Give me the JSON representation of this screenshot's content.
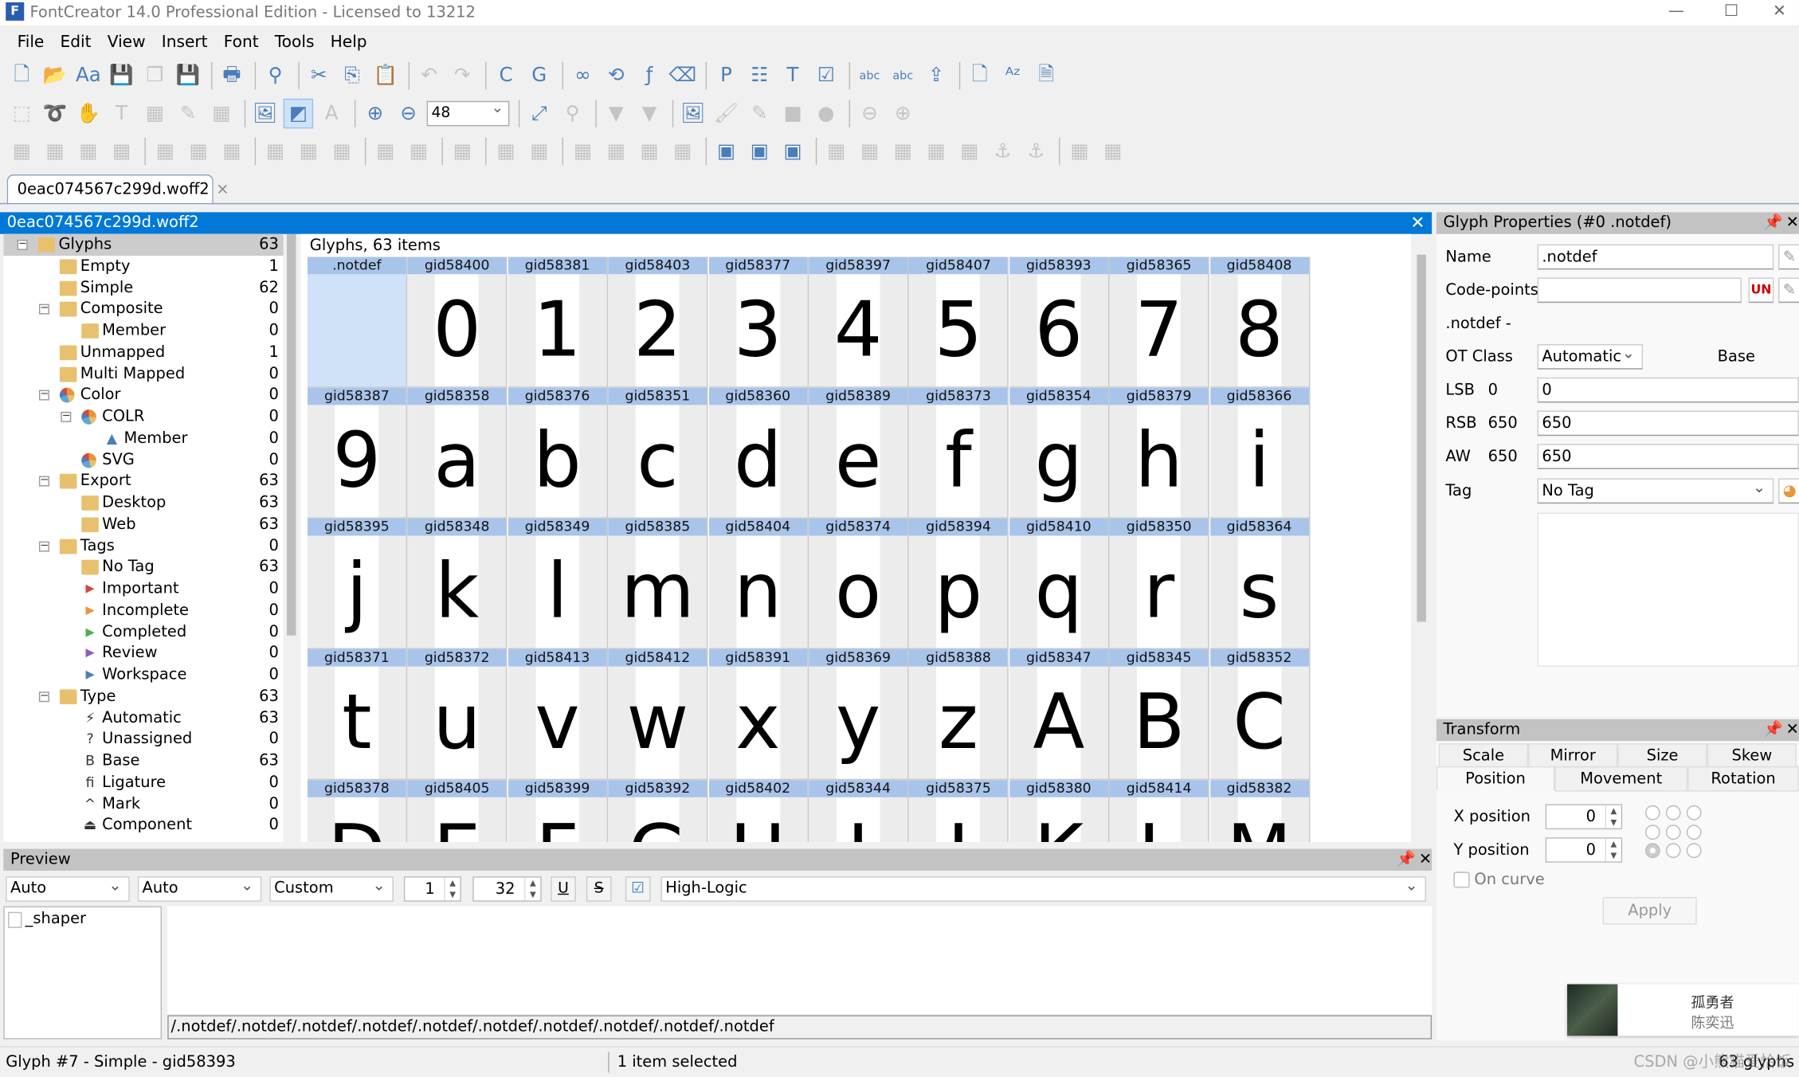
{
  "window": {
    "title": "FontCreator 14.0 Professional Edition - Licensed to 13212",
    "controls": [
      "minimize",
      "maximize",
      "close"
    ]
  },
  "menu": [
    "File",
    "Edit",
    "View",
    "Insert",
    "Font",
    "Tools",
    "Help"
  ],
  "toolbar": {
    "row1": [
      [
        "new-font",
        "e"
      ],
      [
        "open",
        "e"
      ],
      [
        "open-sample",
        "e"
      ],
      [
        "save",
        "e"
      ],
      [
        "save-all",
        "d"
      ],
      [
        "save-as",
        "e"
      ],
      "|",
      [
        "print",
        "e"
      ],
      "|",
      [
        "find",
        "e"
      ],
      "|",
      [
        "cut",
        "e"
      ],
      [
        "copy",
        "e"
      ],
      [
        "paste",
        "e"
      ],
      "|",
      [
        "undo",
        "d"
      ],
      [
        "redo",
        "d"
      ],
      "|",
      [
        "insert-codepoint",
        "e"
      ],
      [
        "insert-glyph",
        "e"
      ],
      "|",
      [
        "link",
        "e"
      ],
      [
        "unlink",
        "e"
      ],
      [
        "formula",
        "e"
      ],
      [
        "eraser",
        "e"
      ],
      "|",
      [
        "properties",
        "e"
      ],
      [
        "edit-table",
        "e"
      ],
      [
        "replace-text",
        "e"
      ],
      [
        "validate",
        "e"
      ],
      "|",
      [
        "spell-check",
        "e"
      ],
      [
        "web-check",
        "e"
      ],
      [
        "install-font",
        "e"
      ],
      "|",
      [
        "new-page",
        "e"
      ],
      [
        "sort-az",
        "e"
      ],
      [
        "export",
        "e"
      ]
    ],
    "row2": [
      [
        "select-rect",
        "d"
      ],
      [
        "lasso",
        "d"
      ],
      [
        "hand",
        "d"
      ],
      [
        "text-tool",
        "d"
      ],
      [
        "measure",
        "d"
      ],
      [
        "pen",
        "d"
      ],
      [
        "fill",
        "d"
      ],
      "|",
      [
        "background-image",
        "e"
      ],
      [
        "show-hide",
        "a"
      ],
      [
        "font-style",
        "d"
      ],
      "|",
      [
        "zoom-in",
        "e"
      ],
      [
        "zoom-out",
        "e"
      ],
      "zoom",
      "|",
      [
        "fit",
        "e"
      ],
      [
        "zoom-rect",
        "d"
      ],
      "|",
      [
        "triangle-down",
        "d"
      ],
      [
        "triangle-pin",
        "d"
      ],
      "|",
      [
        "image-insert",
        "e"
      ],
      [
        "brush",
        "d"
      ],
      [
        "pencil",
        "d"
      ],
      [
        "rectangle",
        "d"
      ],
      [
        "ellipse",
        "d"
      ],
      "|",
      [
        "back",
        "d"
      ],
      [
        "forward",
        "d"
      ]
    ],
    "row3": [
      [
        "group1",
        "d"
      ],
      [
        "group2",
        "d"
      ],
      [
        "group3",
        "d"
      ],
      [
        "group4",
        "d"
      ],
      "|",
      [
        "align-left",
        "d"
      ],
      [
        "align-center",
        "d"
      ],
      [
        "align-right",
        "d"
      ],
      "|",
      [
        "align-top",
        "d"
      ],
      [
        "align-middle",
        "d"
      ],
      [
        "align-bottom",
        "d"
      ],
      "|",
      [
        "distribute-h",
        "d"
      ],
      [
        "distribute-v",
        "d"
      ],
      "|",
      [
        "glyph-ref",
        "d"
      ],
      "|",
      [
        "rotate",
        "d"
      ],
      [
        "mirror",
        "d"
      ],
      "|",
      [
        "flip-left",
        "d"
      ],
      [
        "flip-v",
        "d"
      ],
      [
        "rotate-left",
        "d"
      ],
      [
        "rotate-right",
        "d"
      ],
      "|",
      [
        "union",
        "e"
      ],
      [
        "intersect",
        "e"
      ],
      [
        "exclude",
        "e"
      ],
      "|",
      [
        "grid",
        "d"
      ],
      [
        "grid-undo",
        "d"
      ],
      [
        "grid-lock",
        "d"
      ],
      [
        "columns",
        "d"
      ],
      [
        "columns-lock",
        "d"
      ],
      [
        "anchor",
        "d"
      ],
      [
        "anchor-lock",
        "d"
      ],
      "|",
      [
        "node",
        "d"
      ],
      [
        "hint",
        "d"
      ]
    ],
    "zoom_value": "48"
  },
  "doc_tab": {
    "label": "0eac074567c299d.woff2",
    "close": "×"
  },
  "doc_header": {
    "title": "0eac074567c299d.woff2",
    "close": "✕"
  },
  "tree": [
    {
      "label": "Glyphs",
      "count": "63",
      "level": 0,
      "icon": "folder",
      "toggle": "−",
      "selected": true
    },
    {
      "label": "Empty",
      "count": "1",
      "level": 1,
      "icon": "folder"
    },
    {
      "label": "Simple",
      "count": "62",
      "level": 1,
      "icon": "folder"
    },
    {
      "label": "Composite",
      "count": "0",
      "level": 1,
      "icon": "folder",
      "toggle": "−"
    },
    {
      "label": "Member",
      "count": "0",
      "level": 2,
      "icon": "folder"
    },
    {
      "label": "Unmapped",
      "count": "1",
      "level": 1,
      "icon": "folder"
    },
    {
      "label": "Multi Mapped",
      "count": "0",
      "level": 1,
      "icon": "folder"
    },
    {
      "label": "Color",
      "count": "0",
      "level": 1,
      "icon": "color-pie",
      "toggle": "−"
    },
    {
      "label": "COLR",
      "count": "0",
      "level": 2,
      "icon": "color-pie",
      "toggle": "−"
    },
    {
      "label": "Member",
      "count": "0",
      "level": 3,
      "icon": "triangle"
    },
    {
      "label": "SVG",
      "count": "0",
      "level": 2,
      "icon": "color-pie"
    },
    {
      "label": "Export",
      "count": "63",
      "level": 1,
      "icon": "folder",
      "toggle": "−"
    },
    {
      "label": "Desktop",
      "count": "63",
      "level": 2,
      "icon": "folder"
    },
    {
      "label": "Web",
      "count": "63",
      "level": 2,
      "icon": "folder"
    },
    {
      "label": "Tags",
      "count": "0",
      "level": 1,
      "icon": "folder",
      "toggle": "−"
    },
    {
      "label": "No Tag",
      "count": "63",
      "level": 2,
      "icon": "folder"
    },
    {
      "label": "Important",
      "count": "0",
      "level": 2,
      "icon": "flag",
      "color": "#d9463b"
    },
    {
      "label": "Incomplete",
      "count": "0",
      "level": 2,
      "icon": "flag",
      "color": "#e8963a"
    },
    {
      "label": "Completed",
      "count": "0",
      "level": 2,
      "icon": "flag",
      "color": "#4caf50"
    },
    {
      "label": "Review",
      "count": "0",
      "level": 2,
      "icon": "flag",
      "color": "#8e5cc7"
    },
    {
      "label": "Workspace",
      "count": "0",
      "level": 2,
      "icon": "flag",
      "color": "#4a7ebb"
    },
    {
      "label": "Type",
      "count": "63",
      "level": 1,
      "icon": "folder",
      "toggle": "−"
    },
    {
      "label": "Automatic",
      "count": "63",
      "level": 2,
      "icon": "lightning",
      "glyph": "⚡"
    },
    {
      "label": "Unassigned",
      "count": "0",
      "level": 2,
      "icon": "question",
      "glyph": "?"
    },
    {
      "label": "Base",
      "count": "63",
      "level": 2,
      "icon": "base",
      "glyph": "B"
    },
    {
      "label": "Ligature",
      "count": "0",
      "level": 2,
      "icon": "ligature",
      "glyph": "fi"
    },
    {
      "label": "Mark",
      "count": "0",
      "level": 2,
      "icon": "mark",
      "glyph": "^"
    },
    {
      "label": "Component",
      "count": "0",
      "level": 2,
      "icon": "component",
      "glyph": "⏏"
    }
  ],
  "grid": {
    "title": "Glyphs, 63 items",
    "rows": [
      [
        [
          ".notdef",
          ""
        ],
        [
          "gid58400",
          "0"
        ],
        [
          "gid58381",
          "1"
        ],
        [
          "gid58403",
          "2"
        ],
        [
          "gid58377",
          "3"
        ],
        [
          "gid58397",
          "4"
        ],
        [
          "gid58407",
          "5"
        ],
        [
          "gid58393",
          "6"
        ],
        [
          "gid58365",
          "7"
        ],
        [
          "gid58408",
          "8"
        ]
      ],
      [
        [
          "gid58387",
          "9"
        ],
        [
          "gid58358",
          "a"
        ],
        [
          "gid58376",
          "b"
        ],
        [
          "gid58351",
          "c"
        ],
        [
          "gid58360",
          "d"
        ],
        [
          "gid58389",
          "e"
        ],
        [
          "gid58373",
          "f"
        ],
        [
          "gid58354",
          "g"
        ],
        [
          "gid58379",
          "h"
        ],
        [
          "gid58366",
          "i"
        ]
      ],
      [
        [
          "gid58395",
          "j"
        ],
        [
          "gid58348",
          "k"
        ],
        [
          "gid58349",
          "l"
        ],
        [
          "gid58385",
          "m"
        ],
        [
          "gid58404",
          "n"
        ],
        [
          "gid58374",
          "o"
        ],
        [
          "gid58394",
          "p"
        ],
        [
          "gid58410",
          "q"
        ],
        [
          "gid58350",
          "r"
        ],
        [
          "gid58364",
          "s"
        ]
      ],
      [
        [
          "gid58371",
          "t"
        ],
        [
          "gid58372",
          "u"
        ],
        [
          "gid58413",
          "v"
        ],
        [
          "gid58412",
          "w"
        ],
        [
          "gid58391",
          "x"
        ],
        [
          "gid58369",
          "y"
        ],
        [
          "gid58388",
          "z"
        ],
        [
          "gid58347",
          "A"
        ],
        [
          "gid58345",
          "B"
        ],
        [
          "gid58352",
          "C"
        ]
      ],
      [
        [
          "gid58378",
          "D"
        ],
        [
          "gid58405",
          "E"
        ],
        [
          "gid58399",
          "F"
        ],
        [
          "gid58392",
          "G"
        ],
        [
          "gid58402",
          "H"
        ],
        [
          "gid58344",
          "I"
        ],
        [
          "gid58375",
          "J"
        ],
        [
          "gid58380",
          "K"
        ],
        [
          "gid58414",
          "L"
        ],
        [
          "gid58382",
          "M"
        ]
      ]
    ],
    "selected": ".notdef"
  },
  "glyph_properties": {
    "title": "Glyph Properties (#0 .notdef)",
    "name_label": "Name",
    "name_value": ".notdef",
    "codepoints_label": "Code-points",
    "codepoints_value": "",
    "info": ".notdef -",
    "otclass_label": "OT Class",
    "otclass_value": "Automatic",
    "otclass_result": "Base",
    "lsb_label": "LSB",
    "lsb_current": "0",
    "lsb_value": "0",
    "rsb_label": "RSB",
    "rsb_current": "650",
    "rsb_value": "650",
    "aw_label": "AW",
    "aw_current": "650",
    "aw_value": "650",
    "tag_label": "Tag",
    "tag_value": "No Tag"
  },
  "transform": {
    "title": "Transform",
    "tabs_top": [
      "Scale",
      "Mirror",
      "Size",
      "Skew"
    ],
    "tabs_bottom": [
      "Position",
      "Movement",
      "Rotation"
    ],
    "active_tab": "Position",
    "x_label": "X position",
    "x_value": "0",
    "y_label": "Y position",
    "y_value": "0",
    "origin_selected": "bottom-left",
    "oncurve_label": "On curve",
    "oncurve_checked": false,
    "apply_label": "Apply"
  },
  "music_popup": {
    "title": "孤勇者",
    "artist": "陈奕迅"
  },
  "preview": {
    "title": "Preview",
    "select1": "Auto",
    "select2": "Auto",
    "select3": "Custom",
    "spin1": "1",
    "spin2": "32",
    "underline": "U",
    "strike": "S",
    "checked": true,
    "shaper_select": "High-Logic",
    "list_item": "_shaper",
    "text": "/.notdef/.notdef/.notdef/.notdef/.notdef/.notdef/.notdef/.notdef/.notdef/.notdef"
  },
  "status": {
    "left": "Glyph #7 - Simple - gid58393",
    "middle": "1 item selected",
    "right": "63 glyphs",
    "watermark": "CSDN @小熊猫爱恰饭"
  }
}
